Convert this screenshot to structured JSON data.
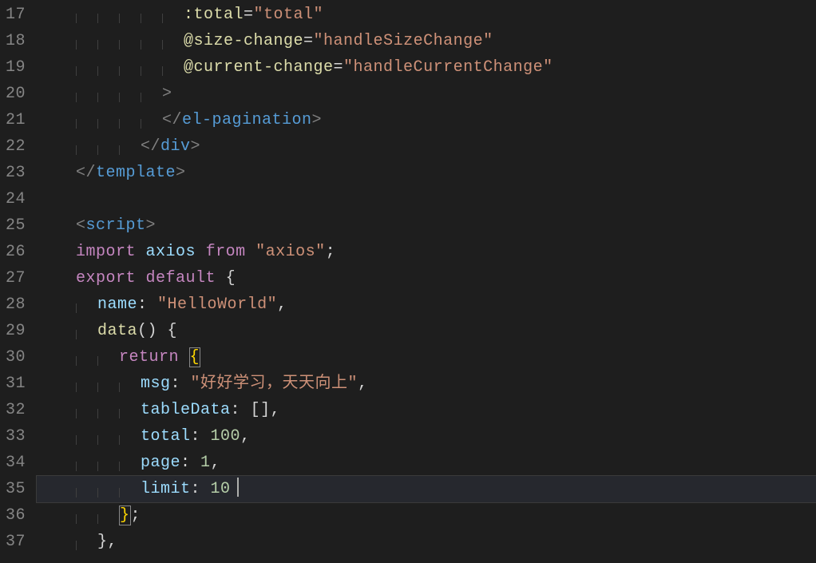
{
  "lines": [
    {
      "num": "17",
      "indent": 6,
      "tokens": [
        {
          "t": "t-attr-yellow",
          "s": ":total"
        },
        {
          "t": "t-white",
          "s": "="
        },
        {
          "t": "t-str",
          "s": "\"total\""
        }
      ]
    },
    {
      "num": "18",
      "indent": 6,
      "tokens": [
        {
          "t": "t-attr-yellow",
          "s": "@size-change"
        },
        {
          "t": "t-white",
          "s": "="
        },
        {
          "t": "t-str",
          "s": "\"handleSizeChange\""
        }
      ]
    },
    {
      "num": "19",
      "indent": 6,
      "tokens": [
        {
          "t": "t-attr-yellow",
          "s": "@current-change"
        },
        {
          "t": "t-white",
          "s": "="
        },
        {
          "t": "t-str",
          "s": "\"handleCurrentChange\""
        }
      ]
    },
    {
      "num": "20",
      "indent": 5,
      "tokens": [
        {
          "t": "t-punct",
          "s": ">"
        }
      ]
    },
    {
      "num": "21",
      "indent": 5,
      "tokens": [
        {
          "t": "t-punct",
          "s": "</"
        },
        {
          "t": "t-tag",
          "s": "el-pagination"
        },
        {
          "t": "t-punct",
          "s": ">"
        }
      ]
    },
    {
      "num": "22",
      "indent": 4,
      "tokens": [
        {
          "t": "t-punct",
          "s": "</"
        },
        {
          "t": "t-tag",
          "s": "div"
        },
        {
          "t": "t-punct",
          "s": ">"
        }
      ]
    },
    {
      "num": "23",
      "indent": 1,
      "tokens": [
        {
          "t": "t-punct",
          "s": "</"
        },
        {
          "t": "t-tag",
          "s": "template"
        },
        {
          "t": "t-punct",
          "s": ">"
        }
      ]
    },
    {
      "num": "24",
      "indent": 0,
      "tokens": []
    },
    {
      "num": "25",
      "indent": 1,
      "tokens": [
        {
          "t": "t-punct",
          "s": "<"
        },
        {
          "t": "t-tag",
          "s": "script"
        },
        {
          "t": "t-punct",
          "s": ">"
        }
      ]
    },
    {
      "num": "26",
      "indent": 1,
      "tokens": [
        {
          "t": "t-kw-exp",
          "s": "import"
        },
        {
          "t": "",
          "s": " "
        },
        {
          "t": "t-ident",
          "s": "axios"
        },
        {
          "t": "",
          "s": " "
        },
        {
          "t": "t-kw-exp",
          "s": "from"
        },
        {
          "t": "",
          "s": " "
        },
        {
          "t": "t-str",
          "s": "\"axios\""
        },
        {
          "t": "t-white",
          "s": ";"
        }
      ]
    },
    {
      "num": "27",
      "indent": 1,
      "tokens": [
        {
          "t": "t-kw-exp",
          "s": "export"
        },
        {
          "t": "",
          "s": " "
        },
        {
          "t": "t-kw-exp",
          "s": "default"
        },
        {
          "t": "",
          "s": " "
        },
        {
          "t": "t-brace",
          "s": "{"
        }
      ]
    },
    {
      "num": "28",
      "indent": 2,
      "tokens": [
        {
          "t": "t-prop",
          "s": "name"
        },
        {
          "t": "t-white",
          "s": ":"
        },
        {
          "t": "",
          "s": " "
        },
        {
          "t": "t-str",
          "s": "\"HelloWorld\""
        },
        {
          "t": "t-white",
          "s": ","
        }
      ]
    },
    {
      "num": "29",
      "indent": 2,
      "tokens": [
        {
          "t": "t-func",
          "s": "data"
        },
        {
          "t": "t-brace",
          "s": "()"
        },
        {
          "t": "",
          "s": " "
        },
        {
          "t": "t-brace",
          "s": "{"
        }
      ]
    },
    {
      "num": "30",
      "indent": 3,
      "tokens": [
        {
          "t": "t-kw-exp",
          "s": "return"
        },
        {
          "t": "",
          "s": " "
        },
        {
          "t": "t-brace-h",
          "s": "{"
        }
      ]
    },
    {
      "num": "31",
      "indent": 4,
      "tokens": [
        {
          "t": "t-prop",
          "s": "msg"
        },
        {
          "t": "t-white",
          "s": ":"
        },
        {
          "t": "",
          "s": " "
        },
        {
          "t": "t-str",
          "s": "\"好好学习，天天向上\""
        },
        {
          "t": "t-white",
          "s": ","
        }
      ]
    },
    {
      "num": "32",
      "indent": 4,
      "tokens": [
        {
          "t": "t-prop",
          "s": "tableData"
        },
        {
          "t": "t-white",
          "s": ":"
        },
        {
          "t": "",
          "s": " "
        },
        {
          "t": "t-brace",
          "s": "[]"
        },
        {
          "t": "t-white",
          "s": ","
        }
      ]
    },
    {
      "num": "33",
      "indent": 4,
      "tokens": [
        {
          "t": "t-prop",
          "s": "total"
        },
        {
          "t": "t-white",
          "s": ":"
        },
        {
          "t": "",
          "s": " "
        },
        {
          "t": "t-num",
          "s": "100"
        },
        {
          "t": "t-white",
          "s": ","
        }
      ]
    },
    {
      "num": "34",
      "indent": 4,
      "tokens": [
        {
          "t": "t-prop",
          "s": "page"
        },
        {
          "t": "t-white",
          "s": ":"
        },
        {
          "t": "",
          "s": " "
        },
        {
          "t": "t-num",
          "s": "1"
        },
        {
          "t": "t-white",
          "s": ","
        }
      ]
    },
    {
      "num": "35",
      "indent": 4,
      "current": true,
      "cursor": true,
      "tokens": [
        {
          "t": "t-prop",
          "s": "limit"
        },
        {
          "t": "t-white",
          "s": ":"
        },
        {
          "t": "",
          "s": " "
        },
        {
          "t": "t-num",
          "s": "10"
        }
      ]
    },
    {
      "num": "36",
      "indent": 3,
      "tokens": [
        {
          "t": "t-brace-h",
          "s": "}"
        },
        {
          "t": "t-white",
          "s": ";"
        }
      ]
    },
    {
      "num": "37",
      "indent": 2,
      "tokens": [
        {
          "t": "t-brace",
          "s": "}"
        },
        {
          "t": "t-white",
          "s": ","
        }
      ]
    }
  ]
}
